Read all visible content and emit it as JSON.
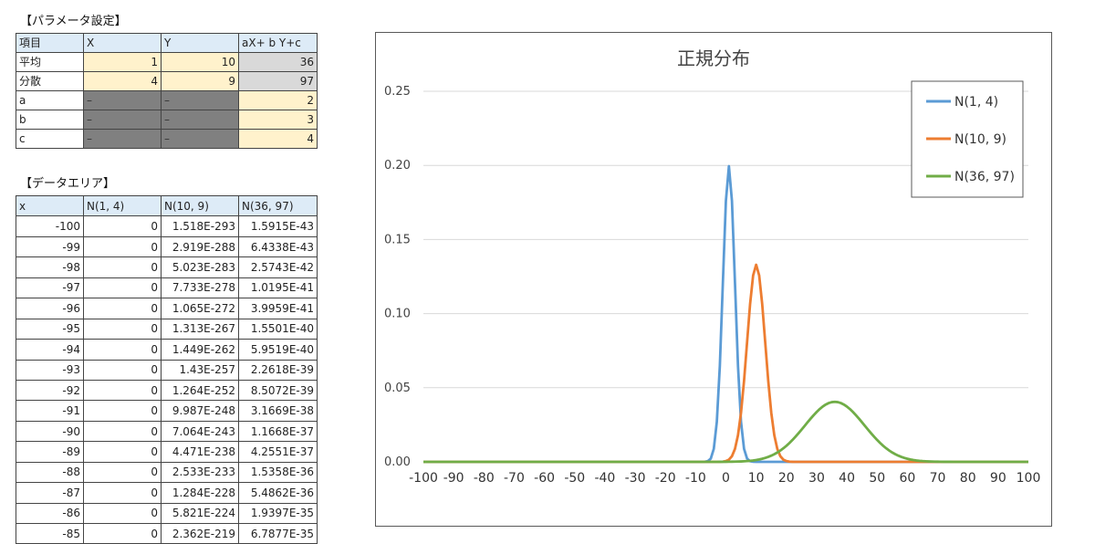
{
  "params": {
    "title": "【パラメータ設定】",
    "headers": [
      "項目",
      "X",
      "Y",
      "aX+ b Y+c"
    ],
    "rows": [
      {
        "label": "平均",
        "x": "1",
        "y": "10",
        "result": "36"
      },
      {
        "label": "分散",
        "x": "4",
        "y": "9",
        "result": "97"
      },
      {
        "label": "a",
        "x": "–",
        "y": "–",
        "result": "2"
      },
      {
        "label": "b",
        "x": "–",
        "y": "–",
        "result": "3"
      },
      {
        "label": "c",
        "x": "–",
        "y": "–",
        "result": "4"
      }
    ]
  },
  "data_area": {
    "title": "【データエリア】",
    "headers": [
      "x",
      "N(1, 4)",
      "N(10, 9)",
      "N(36, 97)"
    ],
    "rows": [
      [
        "-100",
        "0",
        "1.518E-293",
        "1.5915E-43"
      ],
      [
        "-99",
        "0",
        "2.919E-288",
        "6.4338E-43"
      ],
      [
        "-98",
        "0",
        "5.023E-283",
        "2.5743E-42"
      ],
      [
        "-97",
        "0",
        "7.733E-278",
        "1.0195E-41"
      ],
      [
        "-96",
        "0",
        "1.065E-272",
        "3.9959E-41"
      ],
      [
        "-95",
        "0",
        "1.313E-267",
        "1.5501E-40"
      ],
      [
        "-94",
        "0",
        "1.449E-262",
        "5.9519E-40"
      ],
      [
        "-93",
        "0",
        "1.43E-257",
        "2.2618E-39"
      ],
      [
        "-92",
        "0",
        "1.264E-252",
        "8.5072E-39"
      ],
      [
        "-91",
        "0",
        "9.987E-248",
        "3.1669E-38"
      ],
      [
        "-90",
        "0",
        "7.064E-243",
        "1.1668E-37"
      ],
      [
        "-89",
        "0",
        "4.471E-238",
        "4.2551E-37"
      ],
      [
        "-88",
        "0",
        "2.533E-233",
        "1.5358E-36"
      ],
      [
        "-87",
        "0",
        "1.284E-228",
        "5.4862E-36"
      ],
      [
        "-86",
        "0",
        "5.821E-224",
        "1.9397E-35"
      ],
      [
        "-85",
        "0",
        "2.362E-219",
        "6.7877E-35"
      ]
    ]
  },
  "chart_data": {
    "type": "line",
    "title": "正規分布",
    "xlabel": "",
    "ylabel": "",
    "xlim": [
      -100,
      100
    ],
    "ylim": [
      0,
      0.25
    ],
    "xticks": [
      "-100",
      "-90",
      "-80",
      "-70",
      "-60",
      "-50",
      "-40",
      "-30",
      "-20",
      "-10",
      "0",
      "10",
      "20",
      "30",
      "40",
      "50",
      "60",
      "70",
      "80",
      "90",
      "100"
    ],
    "yticks": [
      "0.00",
      "0.05",
      "0.10",
      "0.15",
      "0.20",
      "0.25"
    ],
    "grid": true,
    "legend_position": "top-right",
    "series": [
      {
        "name": "N(1, 4)",
        "mean": 1,
        "variance": 4,
        "color": "#5b9bd5"
      },
      {
        "name": "N(10, 9)",
        "mean": 10,
        "variance": 9,
        "color": "#ed7d31"
      },
      {
        "name": "N(36, 97)",
        "mean": 36,
        "variance": 97,
        "color": "#70ad47"
      }
    ]
  }
}
